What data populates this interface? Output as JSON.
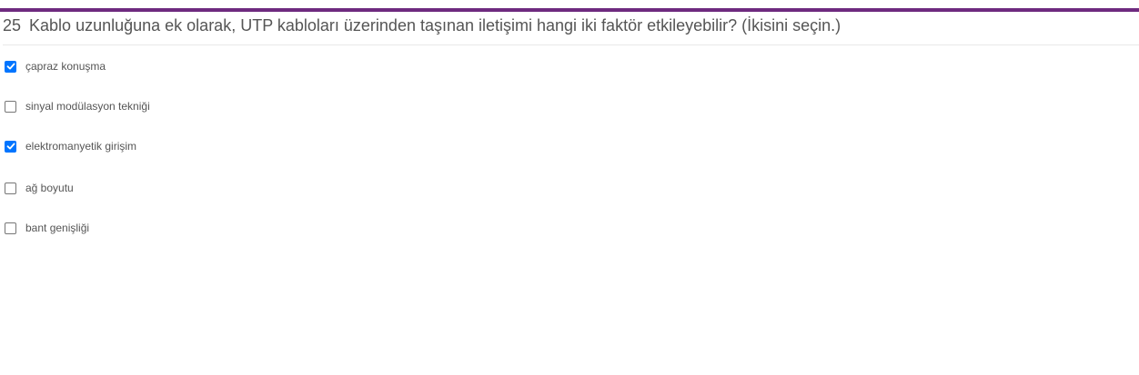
{
  "question": {
    "number": "25",
    "text": "Kablo uzunluğuna ek olarak, UTP kabloları üzerinden taşınan iletişimi hangi iki faktör etkileyebilir? (İkisini seçin.)"
  },
  "options": [
    {
      "label": "çapraz konuşma",
      "checked": true
    },
    {
      "label": "sinyal modülasyon tekniği",
      "checked": false
    },
    {
      "label": "elektromanyetik girişim",
      "checked": true
    },
    {
      "label": "ağ boyutu",
      "checked": false
    },
    {
      "label": "bant genişliği",
      "checked": false
    }
  ],
  "colors": {
    "accent_bar": "#6e2a7f",
    "checkbox_checked": "#0075ff",
    "text": "#555555"
  }
}
